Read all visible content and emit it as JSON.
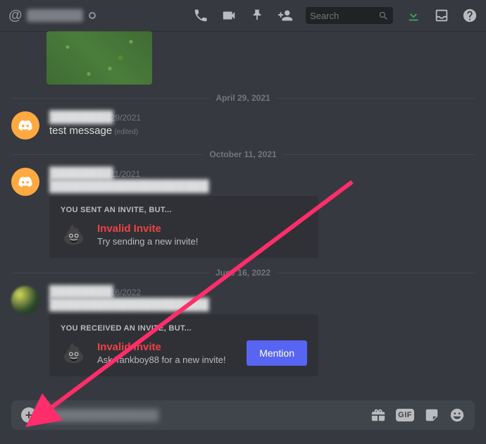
{
  "header": {
    "channel_name": "████████",
    "search_placeholder": "Search"
  },
  "dividers": {
    "d1": "April 29, 2021",
    "d2": "October 11, 2021",
    "d3": "June 16, 2022"
  },
  "messages": {
    "m1": {
      "username": "████████",
      "timestamp": "04/29/2021",
      "text": "test message",
      "edited": "(edited)"
    },
    "m2": {
      "username": "████████",
      "timestamp": "10/11/2021",
      "link": "████████████████████"
    },
    "m3": {
      "username": "████████",
      "timestamp": "06/16/2022",
      "link": "████████████████████"
    }
  },
  "invite_sent": {
    "title": "YOU SENT AN INVITE, BUT...",
    "status": "Invalid Invite",
    "subtitle": "Try sending a new invite!"
  },
  "invite_received": {
    "title": "YOU RECEIVED AN INVITE, BUT...",
    "status": "Invalid Invite",
    "subtitle": "Ask Tankboy88 for a new invite!",
    "button": "Mention"
  },
  "composer": {
    "placeholder_blur": "███████████████"
  },
  "colors": {
    "bg": "#36393f",
    "accent": "#5865f2",
    "danger": "#ed4245",
    "arrow": "#ff2d6b"
  }
}
